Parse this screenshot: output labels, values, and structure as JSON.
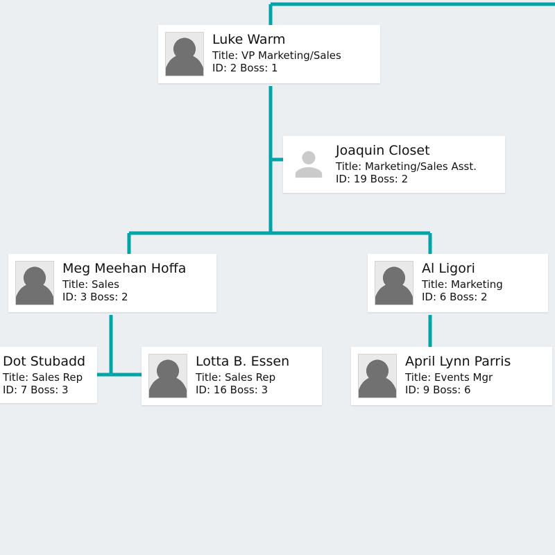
{
  "connector_color": "#00a4a6",
  "nodes": {
    "luke": {
      "name": "Luke Warm",
      "title": "Title: VP Marketing/Sales",
      "idline": "ID: 2  Boss: 1"
    },
    "joaquin": {
      "name": "Joaquin Closet",
      "title": "Title:  Marketing/Sales Asst.",
      "idline": "ID: 19 Boss: 2"
    },
    "meg": {
      "name": "Meg Meehan Hoffa",
      "title": "Title: Sales",
      "idline": "ID: 3  Boss: 2"
    },
    "al": {
      "name": "Al Ligori",
      "title": "Title: Marketing",
      "idline": "ID: 6  Boss: 2"
    },
    "dot": {
      "name": "Dot Stubadd",
      "title": "Title: Sales Rep",
      "idline": "ID: 7  Boss: 3"
    },
    "lotta": {
      "name": "Lotta B. Essen",
      "title": "Title:  Sales Rep",
      "idline": "ID: 16 Boss: 3"
    },
    "april": {
      "name": "April Lynn Parris",
      "title": "Title: Events Mgr",
      "idline": "ID: 9  Boss: 6"
    }
  },
  "chart_data": {
    "type": "org-chart",
    "people": [
      {
        "id": 2,
        "boss": 1,
        "name": "Luke Warm",
        "title": "VP Marketing/Sales"
      },
      {
        "id": 19,
        "boss": 2,
        "name": "Joaquin Closet",
        "title": "Marketing/Sales Asst.",
        "assistant": true
      },
      {
        "id": 3,
        "boss": 2,
        "name": "Meg Meehan Hoffa",
        "title": "Sales"
      },
      {
        "id": 6,
        "boss": 2,
        "name": "Al Ligori",
        "title": "Marketing"
      },
      {
        "id": 7,
        "boss": 3,
        "name": "Dot Stubadd",
        "title": "Sales Rep"
      },
      {
        "id": 16,
        "boss": 3,
        "name": "Lotta B. Essen",
        "title": "Sales Rep"
      },
      {
        "id": 9,
        "boss": 6,
        "name": "April Lynn Parris",
        "title": "Events Mgr"
      }
    ]
  }
}
